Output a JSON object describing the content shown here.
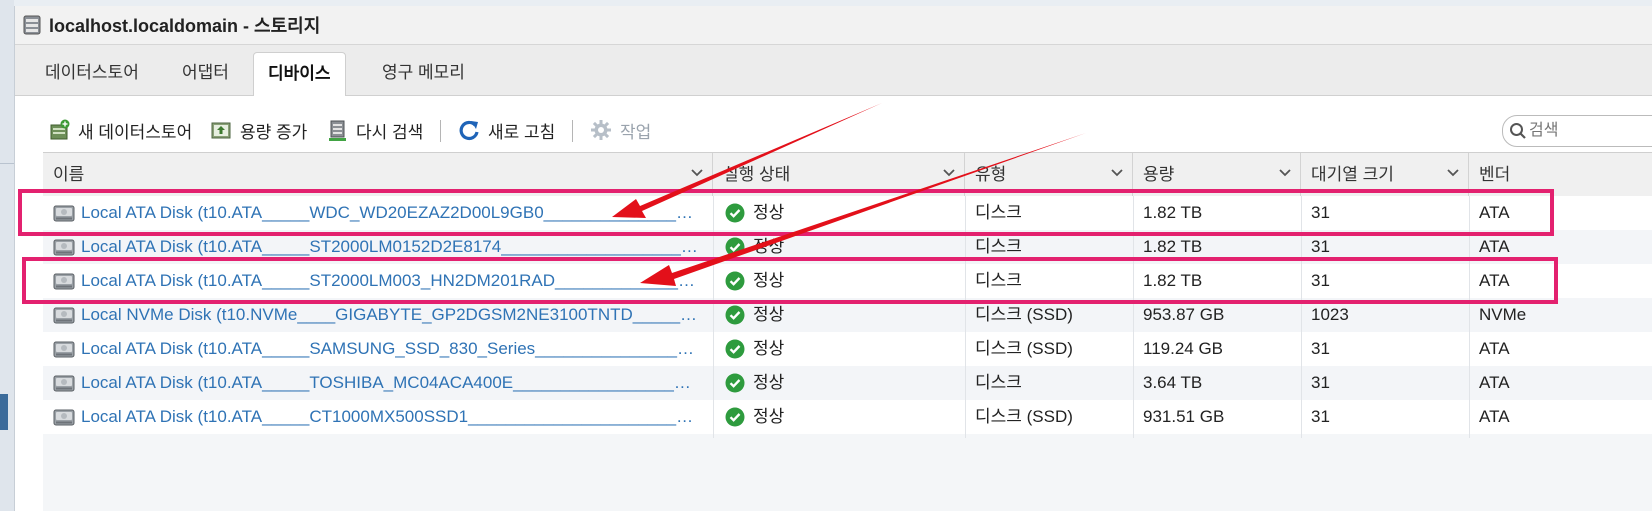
{
  "window": {
    "title": "localhost.localdomain - 스토리지"
  },
  "tabs": [
    {
      "label": "데이터스토어",
      "active": false
    },
    {
      "label": "어댑터",
      "active": false
    },
    {
      "label": "디바이스",
      "active": true
    },
    {
      "label": "영구 메모리",
      "active": false
    }
  ],
  "toolbar": {
    "new_datastore": "새 데이터스토어",
    "increase_capacity": "용량 증가",
    "rescan": "다시 검색",
    "refresh": "새로 고침",
    "actions": "작업",
    "search_placeholder": "검색"
  },
  "columns": [
    "이름",
    "실행 상태",
    "유형",
    "용량",
    "대기열 크기",
    "벤더"
  ],
  "rows": [
    {
      "name": "Local ATA Disk (t10.ATA_____WDC_WD20EZAZ2D00L9GB0_________________",
      "status": "정상",
      "type": "디스크",
      "capacity": "1.82 TB",
      "queue": "31",
      "vendor": "ATA",
      "highlighted": true
    },
    {
      "name": "Local ATA Disk (t10.ATA_____ST2000LM0152D2E8174_____________________",
      "status": "정상",
      "type": "디스크",
      "capacity": "1.82 TB",
      "queue": "31",
      "vendor": "ATA",
      "highlighted": false
    },
    {
      "name": "Local ATA Disk (t10.ATA_____ST2000LM003_HN2DM201RAD__________________",
      "status": "정상",
      "type": "디스크",
      "capacity": "1.82 TB",
      "queue": "31",
      "vendor": "ATA",
      "highlighted": true
    },
    {
      "name": "Local NVMe Disk (t10.NVMe____GIGABYTE_GP2DGSM2NE3100TNTD____________",
      "status": "정상",
      "type": "디스크 (SSD)",
      "capacity": "953.87 GB",
      "queue": "1023",
      "vendor": "NVMe",
      "highlighted": false
    },
    {
      "name": "Local ATA Disk (t10.ATA_____SAMSUNG_SSD_830_Series___________________",
      "status": "정상",
      "type": "디스크 (SSD)",
      "capacity": "119.24 GB",
      "queue": "31",
      "vendor": "ATA",
      "highlighted": false
    },
    {
      "name": "Local ATA Disk (t10.ATA_____TOSHIBA_MC04ACA400E______________________",
      "status": "정상",
      "type": "디스크",
      "capacity": "3.64 TB",
      "queue": "31",
      "vendor": "ATA",
      "highlighted": false
    },
    {
      "name": "Local ATA Disk (t10.ATA_____CT1000MX500SSD1_________________________",
      "status": "정상",
      "type": "디스크 (SSD)",
      "capacity": "931.51 GB",
      "queue": "31",
      "vendor": "ATA",
      "highlighted": false
    }
  ],
  "colors": {
    "highlight": "#e3216f",
    "arrow": "#e3101a",
    "link": "#2f73b5",
    "status_ok": "#2e9b3e"
  },
  "icons": {
    "app": "storage-icon",
    "new_datastore": "add-datastore-icon",
    "increase_capacity": "increase-capacity-icon",
    "rescan": "rescan-icon",
    "refresh": "refresh-icon",
    "actions": "gear-icon",
    "search": "search-icon",
    "disk": "disk-icon",
    "status_ok": "check-circle-icon"
  }
}
